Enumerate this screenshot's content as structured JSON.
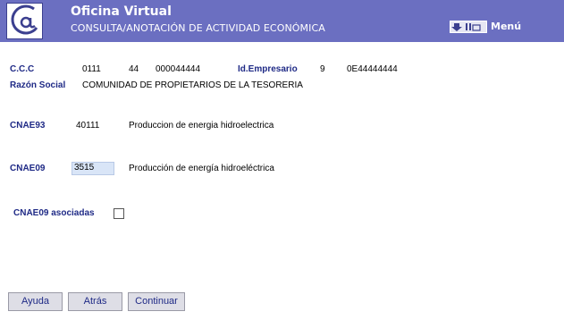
{
  "header": {
    "title": "Oficina Virtual",
    "subtitle": "CONSULTA/ANOTACIÓN DE ACTIVIDAD ECONÓMICA",
    "menu_label": "Menú",
    "menu_icon": "download-icon"
  },
  "form": {
    "ccc_label": "C.C.C",
    "ccc_part1": "0111",
    "ccc_part2": "44",
    "ccc_part3": "000044444",
    "id_empresario_label": "Id.Empresario",
    "id_empresario_part1": "9",
    "id_empresario_part2": "0E44444444",
    "razon_social_label": "Razón Social",
    "razon_social_value": "COMUNIDAD DE PROPIETARIOS DE LA TESORERIA",
    "cnae93_label": "CNAE93",
    "cnae93_code": "40111",
    "cnae93_desc": "Produccion de energia hidroelectrica",
    "cnae09_label": "CNAE09",
    "cnae09_code": "3515",
    "cnae09_desc": "Producción de energía hidroeléctrica",
    "cnae09_asociadas_label": "CNAE09 asociadas",
    "cnae09_asociadas_checked": false
  },
  "buttons": {
    "ayuda": "Ayuda",
    "atras": "Atrás",
    "continuar": "Continuar"
  }
}
